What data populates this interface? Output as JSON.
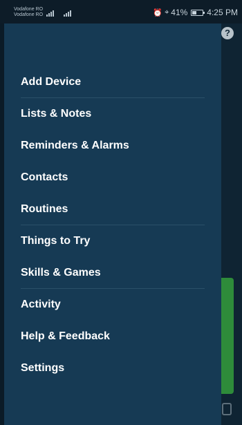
{
  "status_bar": {
    "carrier_1": "Vodafone RO",
    "carrier_2": "Vodafone RO",
    "battery_text": "41%",
    "battery_level": 0.41,
    "time": "4:25 PM"
  },
  "background_app": {
    "help_icon_glyph": "?"
  },
  "menu": {
    "items": [
      {
        "label": "Add Device"
      },
      {
        "label": "Lists & Notes"
      },
      {
        "label": "Reminders & Alarms"
      },
      {
        "label": "Contacts"
      },
      {
        "label": "Routines"
      },
      {
        "label": "Things to Try"
      },
      {
        "label": "Skills & Games"
      },
      {
        "label": "Activity"
      },
      {
        "label": "Help & Feedback"
      },
      {
        "label": "Settings"
      }
    ]
  },
  "colors": {
    "drawer_bg": "#163a54",
    "divider": "#2a5068",
    "text": "#ffffff"
  }
}
